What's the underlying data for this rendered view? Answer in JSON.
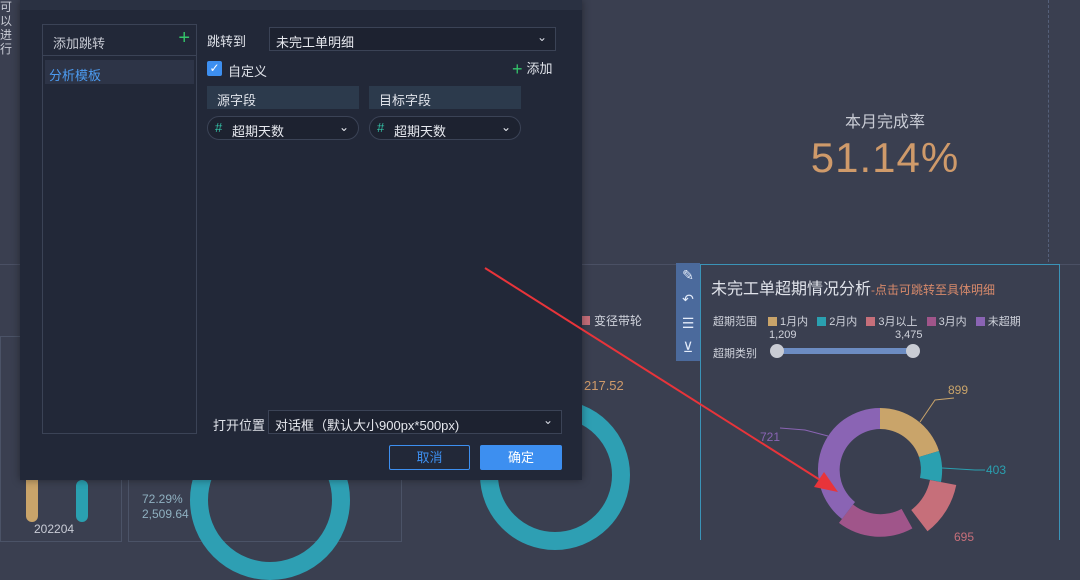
{
  "background": {
    "top_left_fragment": [
      "可以",
      "进行"
    ],
    "kpi": {
      "title": "本月完成率",
      "value": "51.14%"
    },
    "left_panel": {
      "xlabel": "202204"
    },
    "middle_panel": {
      "pct": "72.29%",
      "value": "2,509.64",
      "value2": "217.52",
      "legend_fragment": "变径带轮"
    },
    "chart_toolbar": {
      "icons": [
        "edit-icon",
        "undo-icon",
        "comment-icon",
        "collapse-icon"
      ]
    },
    "chart": {
      "title": "未完工单超期情况分析",
      "subtitle": "-点击可跳转至具体明细",
      "legend_label": "超期范围",
      "legend": [
        {
          "name": "1月内",
          "color": "#c9a46a"
        },
        {
          "name": "2月内",
          "color": "#2aa0b0"
        },
        {
          "name": "3月以上",
          "color": "#c66f7a"
        },
        {
          "name": "3月内",
          "color": "#a0558a"
        },
        {
          "name": "未超期",
          "color": "#8a64b4"
        }
      ],
      "slider_label": "超期类别",
      "slider_min": "1,209",
      "slider_max": "3,475",
      "pie_labels": {
        "a": "899",
        "b": "403",
        "c": "695",
        "d": "721"
      }
    }
  },
  "dialog": {
    "sidebar_header": "添加跳转",
    "sidebar_item": "分析模板",
    "jump_to_label": "跳转到",
    "jump_to_value": "未完工单明细",
    "custom_label": "自定义",
    "add_label": "添加",
    "source_field_header": "源字段",
    "target_field_header": "目标字段",
    "source_field_value": "超期天数",
    "target_field_value": "超期天数",
    "open_position_label": "打开位置",
    "open_position_value": "对话框（默认大小900px*500px)",
    "cancel_label": "取消",
    "ok_label": "确定"
  }
}
